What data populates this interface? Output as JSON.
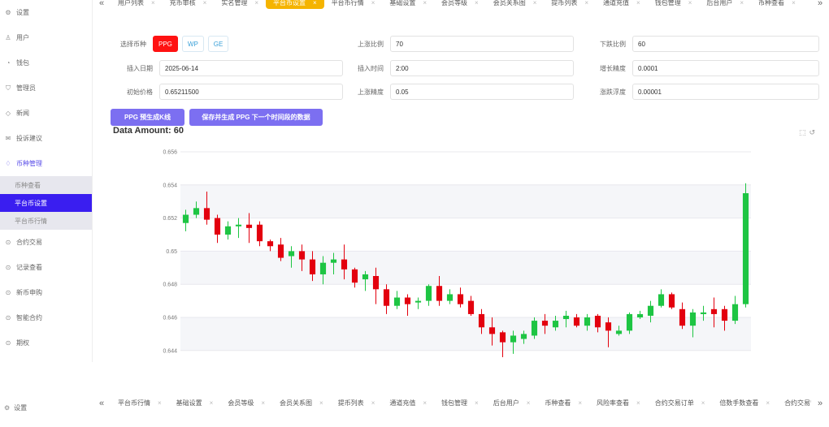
{
  "sidebar": {
    "items": [
      {
        "icon": "gear-icon",
        "glyph": "⚙",
        "label": "设置"
      },
      {
        "icon": "user-icon",
        "glyph": "♙",
        "label": "用户"
      },
      {
        "icon": "wallet-icon",
        "glyph": "◔",
        "label": "钱包"
      },
      {
        "icon": "shield-icon",
        "glyph": "⛉",
        "label": "管理员"
      },
      {
        "icon": "news-icon",
        "glyph": "◇",
        "label": "新闻"
      },
      {
        "icon": "complaint-icon",
        "glyph": "✉",
        "label": "投诉建议"
      },
      {
        "icon": "currency-icon",
        "glyph": "♢",
        "label": "币种管理"
      }
    ],
    "submenu": [
      {
        "label": "币种查看"
      },
      {
        "label": "平台币设置"
      },
      {
        "label": "平台币行情"
      }
    ],
    "items_after": [
      {
        "icon": "contract-icon",
        "glyph": "⊙",
        "label": "合约交易"
      },
      {
        "icon": "record-icon",
        "glyph": "⊙",
        "label": "记录查看"
      },
      {
        "icon": "newcoin-icon",
        "glyph": "⊙",
        "label": "新币申购"
      },
      {
        "icon": "smart-contract-icon",
        "glyph": "⊙",
        "label": "智能合约"
      },
      {
        "icon": "option-icon",
        "glyph": "⊙",
        "label": "期权"
      }
    ]
  },
  "top_tabs": {
    "items": [
      "用户列表",
      "充币审核",
      "实名管理",
      "平台币设置",
      "平台币行情",
      "基础设置",
      "会员等级",
      "会员关系图",
      "提币列表",
      "通道充值",
      "钱包管理",
      "后台用户",
      "币种查看"
    ],
    "active_index": 3
  },
  "bottom_tabs": {
    "items": [
      "平台币行情",
      "基础设置",
      "会员等级",
      "会员关系图",
      "提币列表",
      "通道充值",
      "钱包管理",
      "后台用户",
      "币种查看",
      "风险率查看",
      "合约交易订单",
      "倍数手数查看",
      "合约交易管理"
    ]
  },
  "form": {
    "coin_label": "选择币种",
    "coins": [
      "PPG",
      "WP",
      "GE"
    ],
    "selected_coin": "PPG",
    "rise_ratio_label": "上涨比例",
    "rise_ratio_value": "70",
    "fall_ratio_label": "下跌比例",
    "fall_ratio_value": "60",
    "date_label": "插入日期",
    "date_value": "2025-06-14",
    "time_label": "插入时间",
    "time_value": "2:00",
    "growth_precision_label": "增长精度",
    "growth_precision_value": "0.0001",
    "init_price_label": "初始价格",
    "init_price_value": "0.65211500",
    "rise_precision_label": "上涨精度",
    "rise_precision_value": "0.05",
    "float_label": "涨跌浮度",
    "float_value": "0.00001"
  },
  "actions": {
    "generate_label": "PPG 预生成K线",
    "save_label": "保存并生成 PPG 下一个时间段的数据"
  },
  "data_amount": "Data Amount: 60",
  "bottom_settings_label": "设置",
  "colors": {
    "up": "#1ec543",
    "down": "#e3000e",
    "accent": "#3a1ef0",
    "tab_active": "#f5b400",
    "action": "#7c6ff1"
  },
  "chart_data": {
    "type": "candlestick",
    "ylim": [
      0.6435,
      0.656
    ],
    "yticks": [
      "0.656",
      "0.654",
      "0.652",
      "0.65",
      "0.648",
      "0.646",
      "0.644"
    ],
    "candles": [
      [
        0.6517,
        0.6522,
        0.6512,
        0.6525
      ],
      [
        0.6522,
        0.6526,
        0.652,
        0.653
      ],
      [
        0.6526,
        0.6519,
        0.6516,
        0.6536
      ],
      [
        0.652,
        0.651,
        0.6505,
        0.6522
      ],
      [
        0.651,
        0.6515,
        0.6507,
        0.6518
      ],
      [
        0.6515,
        0.6516,
        0.6508,
        0.652
      ],
      [
        0.6516,
        0.6514,
        0.6505,
        0.6523
      ],
      [
        0.6516,
        0.6506,
        0.6503,
        0.6518
      ],
      [
        0.6506,
        0.6503,
        0.65,
        0.6507
      ],
      [
        0.6504,
        0.6496,
        0.6494,
        0.6508
      ],
      [
        0.6497,
        0.65,
        0.649,
        0.6503
      ],
      [
        0.65,
        0.6495,
        0.6488,
        0.6504
      ],
      [
        0.6495,
        0.6486,
        0.6482,
        0.65
      ],
      [
        0.6486,
        0.6493,
        0.648,
        0.6497
      ],
      [
        0.6493,
        0.6495,
        0.6486,
        0.6499
      ],
      [
        0.6495,
        0.6489,
        0.6483,
        0.6504
      ],
      [
        0.6489,
        0.6481,
        0.6478,
        0.649
      ],
      [
        0.6483,
        0.6486,
        0.6476,
        0.6488
      ],
      [
        0.6485,
        0.6477,
        0.6468,
        0.649
      ],
      [
        0.6477,
        0.6467,
        0.6462,
        0.648
      ],
      [
        0.6467,
        0.6472,
        0.6465,
        0.6476
      ],
      [
        0.6472,
        0.6468,
        0.6461,
        0.6474
      ],
      [
        0.6469,
        0.647,
        0.6465,
        0.6472
      ],
      [
        0.647,
        0.6479,
        0.6467,
        0.648
      ],
      [
        0.6479,
        0.647,
        0.6467,
        0.6485
      ],
      [
        0.647,
        0.6474,
        0.6468,
        0.6477
      ],
      [
        0.6474,
        0.6468,
        0.6466,
        0.6478
      ],
      [
        0.647,
        0.6462,
        0.6461,
        0.6473
      ],
      [
        0.6462,
        0.6454,
        0.645,
        0.6465
      ],
      [
        0.6454,
        0.645,
        0.6443,
        0.646
      ],
      [
        0.6451,
        0.6445,
        0.6436,
        0.6452
      ],
      [
        0.6445,
        0.6449,
        0.6438,
        0.6452
      ],
      [
        0.6447,
        0.645,
        0.6444,
        0.6452
      ],
      [
        0.6449,
        0.6458,
        0.6447,
        0.646
      ],
      [
        0.6458,
        0.6455,
        0.645,
        0.6462
      ],
      [
        0.6454,
        0.6458,
        0.6452,
        0.6461
      ],
      [
        0.6459,
        0.6461,
        0.6454,
        0.6464
      ],
      [
        0.646,
        0.6455,
        0.6454,
        0.6462
      ],
      [
        0.6455,
        0.646,
        0.6452,
        0.6462
      ],
      [
        0.6461,
        0.6454,
        0.6451,
        0.6462
      ],
      [
        0.6457,
        0.6452,
        0.6442,
        0.646
      ],
      [
        0.645,
        0.6452,
        0.6449,
        0.6455
      ],
      [
        0.6452,
        0.6462,
        0.645,
        0.6463
      ],
      [
        0.646,
        0.6462,
        0.6459,
        0.6464
      ],
      [
        0.6461,
        0.6467,
        0.6457,
        0.647
      ],
      [
        0.6467,
        0.6474,
        0.6466,
        0.6477
      ],
      [
        0.6474,
        0.6466,
        0.6465,
        0.6475
      ],
      [
        0.6465,
        0.6455,
        0.6453,
        0.6469
      ],
      [
        0.6455,
        0.6463,
        0.6448,
        0.6465
      ],
      [
        0.6462,
        0.6463,
        0.6458,
        0.6467
      ],
      [
        0.6465,
        0.6462,
        0.6454,
        0.6472
      ],
      [
        0.6465,
        0.6458,
        0.6452,
        0.6467
      ],
      [
        0.6458,
        0.6468,
        0.6456,
        0.6473
      ],
      [
        0.6468,
        0.6535,
        0.6466,
        0.6541
      ]
    ]
  }
}
